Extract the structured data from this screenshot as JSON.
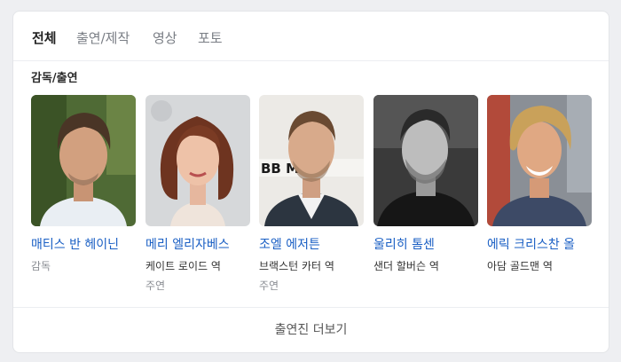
{
  "tabs": [
    {
      "label": "전체"
    },
    {
      "label": "출연/제작"
    },
    {
      "label": "영상"
    },
    {
      "label": "포토"
    }
  ],
  "section_title": "감독/출연",
  "people": [
    {
      "name": "매티스 반 헤이닌",
      "role": "감독",
      "sub": ""
    },
    {
      "name": "메리 엘리자베스",
      "role": "케이트 로이드 역",
      "sub": "주연"
    },
    {
      "name": "조엘 에저튼",
      "role": "브랙스턴 카터 역",
      "sub": "주연"
    },
    {
      "name": "울리히 톰센",
      "role": "샌더 할버슨 역",
      "sub": ""
    },
    {
      "name": "에릭 크리스찬 올",
      "role": "아담 골드맨 역",
      "sub": ""
    }
  ],
  "photo_banner_text": "BB  MERI",
  "more_label": "출연진 더보기",
  "colors": {
    "link": "#1a5fc4",
    "muted": "#8a8d93",
    "active_tab": "#222222"
  }
}
